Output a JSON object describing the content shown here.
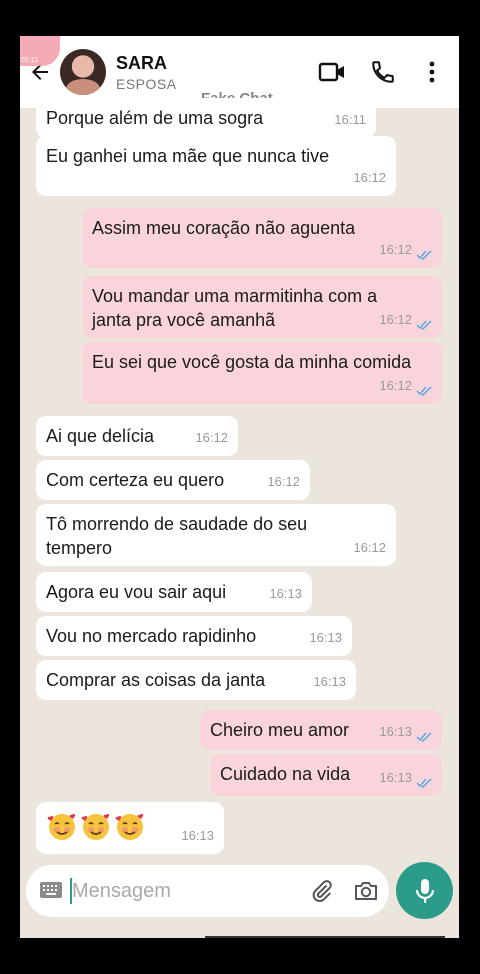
{
  "header": {
    "contact_name": "SARA",
    "contact_status": "ESPOSA",
    "watermark": "Fake Chat",
    "badge_time": "01:11"
  },
  "colors": {
    "incoming_bubble": "#ffffff",
    "outgoing_bubble": "#f9d4db",
    "background": "#ece5dd",
    "accent": "#2b9c8a",
    "read_ticks": "#5aa9e6"
  },
  "messages": [
    {
      "dir": "in",
      "text": "Porque além de uma sogra",
      "time": "16:11"
    },
    {
      "dir": "in",
      "text": "Eu ganhei uma mãe que nunca tive",
      "time": "16:12"
    },
    {
      "dir": "out",
      "text": "Assim meu coração não aguenta",
      "time": "16:12"
    },
    {
      "dir": "out",
      "text": "Vou mandar uma marmitinha com a janta pra você amanhã",
      "time": "16:12"
    },
    {
      "dir": "out",
      "text": "Eu sei que você gosta da minha comida",
      "time": "16:12"
    },
    {
      "dir": "in",
      "text": "Ai que delícia",
      "time": "16:12"
    },
    {
      "dir": "in",
      "text": "Com certeza eu quero",
      "time": "16:12"
    },
    {
      "dir": "in",
      "text": "Tô morrendo de saudade do seu tempero",
      "time": "16:12"
    },
    {
      "dir": "in",
      "text": "Agora eu vou sair aqui",
      "time": "16:13"
    },
    {
      "dir": "in",
      "text": "Vou no mercado rapidinho",
      "time": "16:13"
    },
    {
      "dir": "in",
      "text": "Comprar as coisas da janta",
      "time": "16:13"
    },
    {
      "dir": "out",
      "text": "Cheiro meu amor",
      "time": "16:13"
    },
    {
      "dir": "out",
      "text": "Cuidado na vida",
      "time": "16:13"
    },
    {
      "dir": "in",
      "text": "",
      "emoji": [
        "smiling-face-with-hearts",
        "smiling-face-with-hearts",
        "smiling-face-with-hearts"
      ],
      "time": "16:13"
    }
  ],
  "composer": {
    "placeholder": "Mensagem"
  },
  "icons": {
    "back": "arrow-left-icon",
    "video": "video-call-icon",
    "phone": "phone-icon",
    "menu": "more-vertical-icon",
    "keyboard": "keyboard-icon",
    "attach": "paperclip-icon",
    "camera": "camera-icon",
    "mic": "microphone-icon"
  }
}
